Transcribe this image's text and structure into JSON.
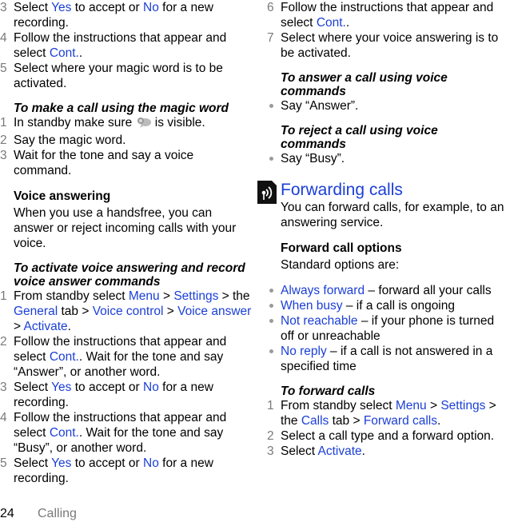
{
  "left_column": {
    "steps_a": [
      {
        "num": "3",
        "parts": [
          {
            "t": "Select "
          },
          {
            "t": "Yes",
            "link": true
          },
          {
            "t": " to accept or "
          },
          {
            "t": "No",
            "link": true
          },
          {
            "t": " for a new recording."
          }
        ]
      },
      {
        "num": "4",
        "parts": [
          {
            "t": "Follow the instructions that appear and select "
          },
          {
            "t": "Cont.",
            "link": true
          },
          {
            "t": "."
          }
        ]
      },
      {
        "num": "5",
        "parts": [
          {
            "t": "Select where your magic word is to be activated."
          }
        ]
      }
    ],
    "magic_heading": "To make a call using the magic word",
    "magic_steps": [
      {
        "num": "1",
        "before": "In standby make sure ",
        "icon": "voice-control-icon",
        "after": " is visible."
      },
      {
        "num": "2",
        "text": "Say the magic word."
      },
      {
        "num": "3",
        "text": "Wait for the tone and say a voice command."
      }
    ],
    "voice_answering_heading": "Voice answering",
    "voice_answering_text": "When you use a handsfree, you can answer or reject incoming calls with your voice.",
    "activate_heading": "To activate voice answering and record voice answer commands",
    "activate_steps": [
      {
        "num": "1",
        "parts": [
          {
            "t": "From standby select "
          },
          {
            "t": "Menu",
            "link": true
          },
          {
            "t": " > "
          },
          {
            "t": "Settings",
            "link": true
          },
          {
            "t": " > the "
          },
          {
            "t": "General",
            "link": true
          },
          {
            "t": " tab > "
          },
          {
            "t": "Voice control",
            "link": true
          },
          {
            "t": " > "
          },
          {
            "t": "Voice answer",
            "link": true
          },
          {
            "t": " > "
          },
          {
            "t": "Activate",
            "link": true
          },
          {
            "t": "."
          }
        ]
      },
      {
        "num": "2",
        "parts": [
          {
            "t": "Follow the instructions that appear and select "
          },
          {
            "t": "Cont.",
            "link": true
          },
          {
            "t": ". Wait for the tone and say “Answer”, or another word."
          }
        ]
      },
      {
        "num": "3",
        "parts": [
          {
            "t": "Select "
          },
          {
            "t": "Yes",
            "link": true
          },
          {
            "t": " to accept or "
          },
          {
            "t": "No",
            "link": true
          },
          {
            "t": " for a new recording."
          }
        ]
      },
      {
        "num": "4",
        "parts": [
          {
            "t": "Follow the instructions that appear and select "
          },
          {
            "t": "Cont.",
            "link": true
          },
          {
            "t": ". Wait for the tone and say “Busy”, or another word."
          }
        ]
      },
      {
        "num": "5",
        "parts": [
          {
            "t": "Select "
          },
          {
            "t": "Yes",
            "link": true
          },
          {
            "t": " to accept or "
          },
          {
            "t": "No",
            "link": true
          },
          {
            "t": " for a new recording."
          }
        ]
      }
    ]
  },
  "right_column": {
    "steps_b": [
      {
        "num": "6",
        "parts": [
          {
            "t": "Follow the instructions that appear and select "
          },
          {
            "t": "Cont.",
            "link": true
          },
          {
            "t": "."
          }
        ]
      },
      {
        "num": "7",
        "parts": [
          {
            "t": "Select where your voice answering is to be activated."
          }
        ]
      }
    ],
    "answer_heading": "To answer a call using voice commands",
    "answer_bullet": "Say “Answer”.",
    "reject_heading": "To reject a call using voice commands",
    "reject_bullet": "Say “Busy”.",
    "forwarding_title": "Forwarding calls",
    "forwarding_intro": "You can forward calls, for example, to an answering service.",
    "options_heading": "Forward call options",
    "options_intro": "Standard options are:",
    "options": [
      {
        "label": "Always forward",
        "desc": " – forward all your calls"
      },
      {
        "label": "When busy",
        "desc": " – if a call is ongoing"
      },
      {
        "label": "Not reachable",
        "desc": " – if your phone is turned off or unreachable"
      },
      {
        "label": "No reply",
        "desc": " – if a call is not answered in a specified time"
      }
    ],
    "forward_heading": "To forward calls",
    "forward_steps": [
      {
        "num": "1",
        "parts": [
          {
            "t": "From standby select "
          },
          {
            "t": "Menu",
            "link": true
          },
          {
            "t": " > "
          },
          {
            "t": "Settings",
            "link": true
          },
          {
            "t": " > the "
          },
          {
            "t": "Calls",
            "link": true
          },
          {
            "t": " tab > "
          },
          {
            "t": "Forward calls",
            "link": true
          },
          {
            "t": "."
          }
        ]
      },
      {
        "num": "2",
        "parts": [
          {
            "t": "Select a call type and a forward option."
          }
        ]
      },
      {
        "num": "3",
        "parts": [
          {
            "t": "Select "
          },
          {
            "t": "Activate",
            "link": true
          },
          {
            "t": "."
          }
        ]
      }
    ]
  },
  "footer": {
    "page_number": "24",
    "section": "Calling"
  },
  "colors": {
    "link": "#1b3fd6",
    "step_number": "#7a7a7a"
  }
}
